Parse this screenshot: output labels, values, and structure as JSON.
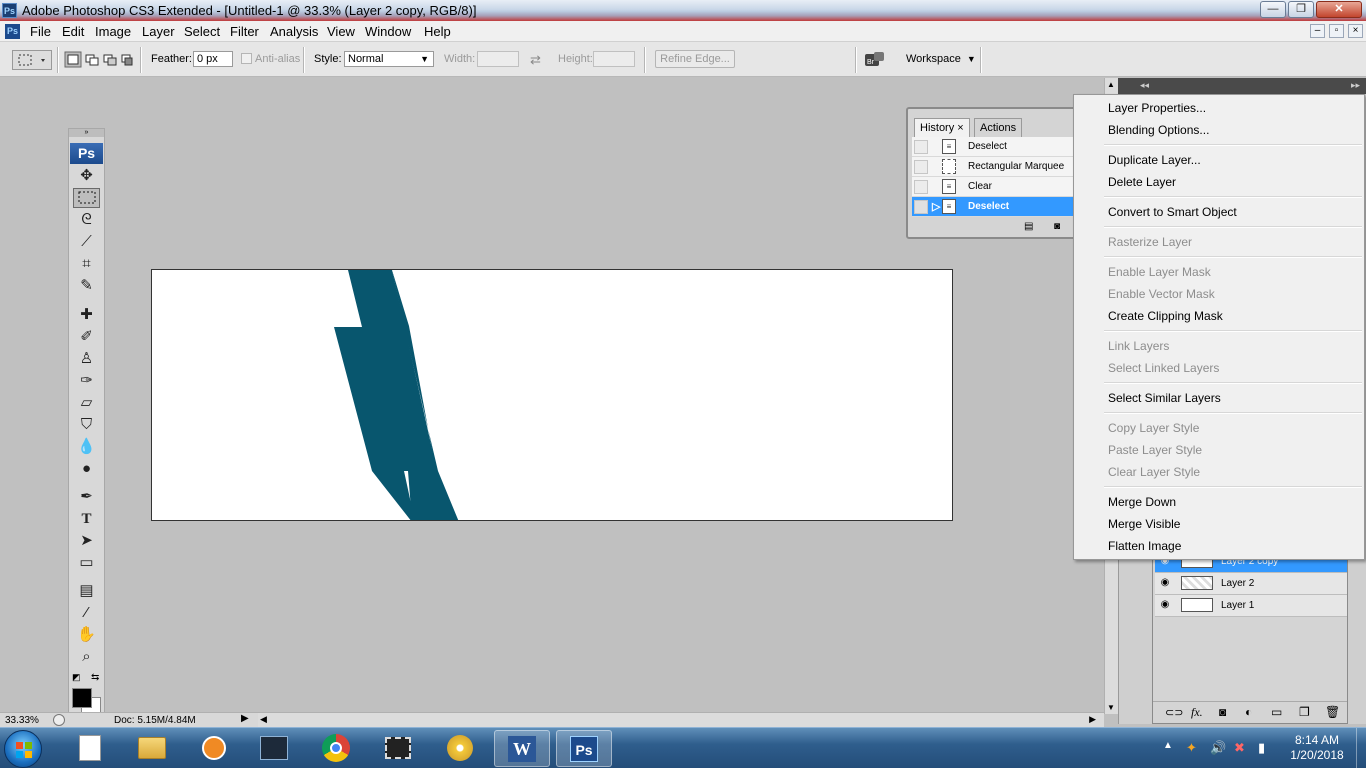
{
  "window": {
    "title": "Adobe Photoshop CS3 Extended - [Untitled-1 @ 33.3% (Layer 2 copy, RGB/8)]",
    "app_badge": "Ps",
    "btn_minimize": "—",
    "btn_restore": "❐",
    "btn_close": "✕"
  },
  "menubar": {
    "items": [
      "File",
      "Edit",
      "Image",
      "Layer",
      "Select",
      "Filter",
      "Analysis",
      "View",
      "Window",
      "Help"
    ],
    "doc_min": "–",
    "doc_restore": "▫",
    "doc_close": "×"
  },
  "options": {
    "feather_label": "Feather:",
    "feather_value": "0 px",
    "antialias_label": "Anti-alias",
    "style_label": "Style:",
    "style_value": "Normal",
    "width_label": "Width:",
    "height_label": "Height:",
    "refine_edge": "Refine Edge...",
    "workspace": "Workspace"
  },
  "tools": {
    "ps_badge": "Ps"
  },
  "history_panel": {
    "tabs": [
      "History",
      "Actions"
    ],
    "tab_close": "×",
    "items": [
      {
        "label": "Deselect",
        "selected": false
      },
      {
        "label": "Rectangular Marquee",
        "selected": false
      },
      {
        "label": "Clear",
        "selected": false
      },
      {
        "label": "Deselect",
        "selected": true
      }
    ]
  },
  "context_menu": {
    "items": [
      {
        "label": "Layer Properties...",
        "enabled": true
      },
      {
        "label": "Blending Options...",
        "enabled": true
      },
      {
        "sep": true
      },
      {
        "label": "Duplicate Layer...",
        "enabled": true
      },
      {
        "label": "Delete Layer",
        "enabled": true
      },
      {
        "sep": true
      },
      {
        "label": "Convert to Smart Object",
        "enabled": true
      },
      {
        "sep": true
      },
      {
        "label": "Rasterize Layer",
        "enabled": false
      },
      {
        "sep": true
      },
      {
        "label": "Enable Layer Mask",
        "enabled": false
      },
      {
        "label": "Enable Vector Mask",
        "enabled": false
      },
      {
        "label": "Create Clipping Mask",
        "enabled": true
      },
      {
        "sep": true
      },
      {
        "label": "Link Layers",
        "enabled": false
      },
      {
        "label": "Select Linked Layers",
        "enabled": false
      },
      {
        "sep": true
      },
      {
        "label": "Select Similar Layers",
        "enabled": true
      },
      {
        "sep": true
      },
      {
        "label": "Copy Layer Style",
        "enabled": false
      },
      {
        "label": "Paste Layer Style",
        "enabled": false
      },
      {
        "label": "Clear Layer Style",
        "enabled": false
      },
      {
        "sep": true
      },
      {
        "label": "Merge Down",
        "enabled": true
      },
      {
        "label": "Merge Visible",
        "enabled": true
      },
      {
        "label": "Flatten Image",
        "enabled": true
      }
    ]
  },
  "layers_panel": {
    "layers": [
      {
        "name": "Layer 2 copy",
        "selected": true
      },
      {
        "name": "Layer 2",
        "selected": false
      },
      {
        "name": "Layer 1",
        "selected": false
      }
    ],
    "footer_fx": "fx."
  },
  "status": {
    "zoom": "33.33%",
    "doc": "Doc: 5.15M/4.84M"
  },
  "taskbar": {
    "time": "8:14 AM",
    "date": "1/20/2018",
    "ps_label": "Ps",
    "word_label": "W"
  },
  "colors": {
    "shape_fill": "#08566e",
    "selection_blue": "#3399ff",
    "ps_blue": "#1c4a8c"
  }
}
